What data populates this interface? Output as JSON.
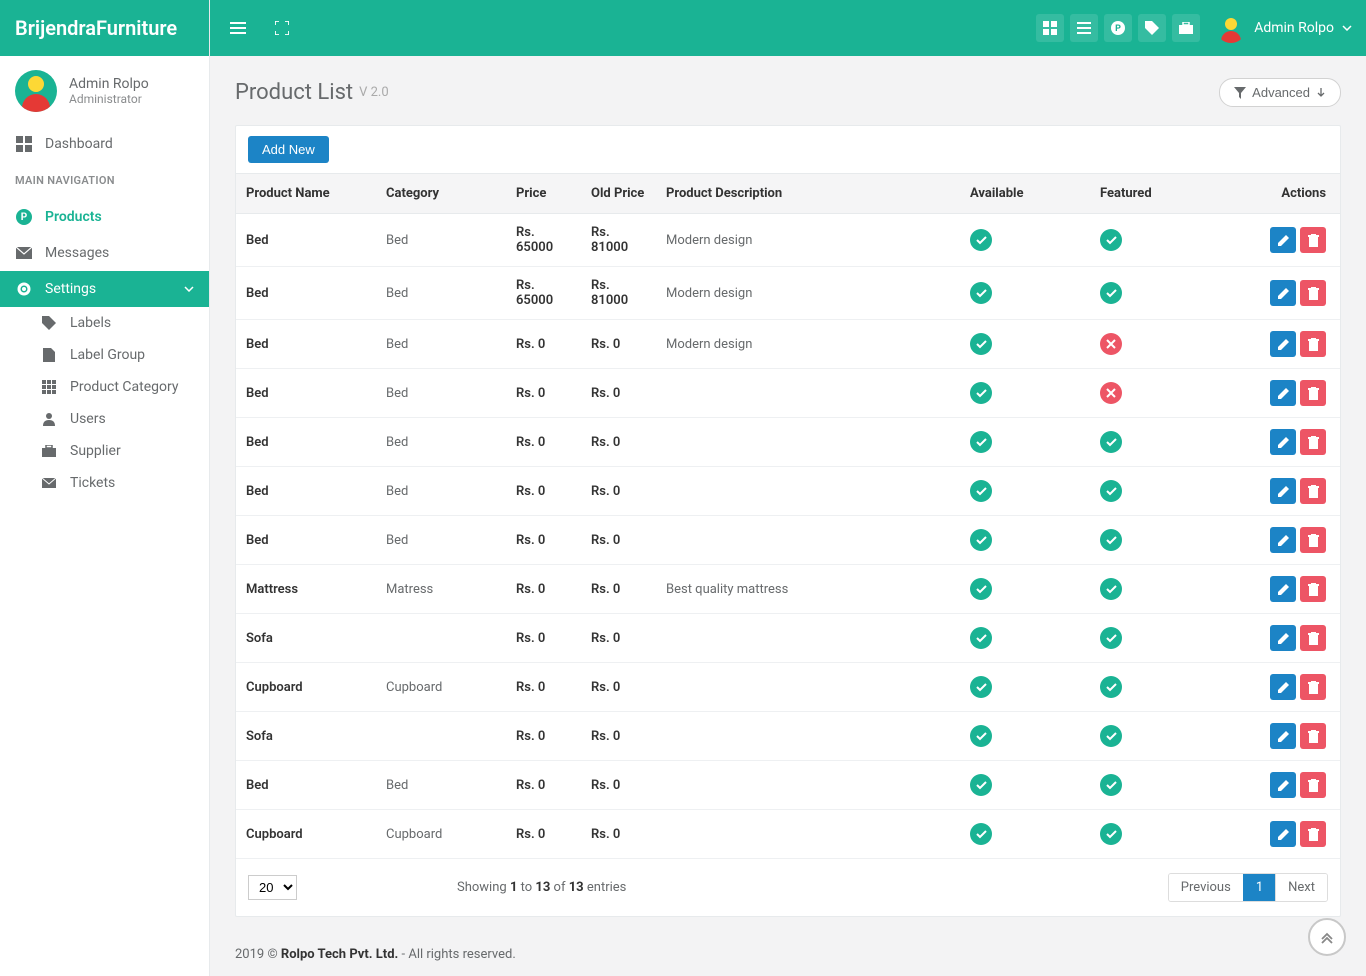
{
  "brand": "BrijendraFurniture",
  "user": {
    "name": "Admin Rolpo",
    "role": "Administrator"
  },
  "sidebar": {
    "dashboard": "Dashboard",
    "section": "MAIN NAVIGATION",
    "products": "Products",
    "messages": "Messages",
    "settings": "Settings",
    "sub": {
      "labels": "Labels",
      "label_group": "Label Group",
      "product_category": "Product Category",
      "users": "Users",
      "supplier": "Supplier",
      "tickets": "Tickets"
    }
  },
  "page": {
    "title": "Product List",
    "version": "V 2.0",
    "advanced": "Advanced"
  },
  "actions": {
    "add_new": "Add New"
  },
  "table": {
    "headers": {
      "name": "Product Name",
      "category": "Category",
      "price": "Price",
      "old_price": "Old Price",
      "description": "Product Description",
      "available": "Available",
      "featured": "Featured",
      "actions": "Actions"
    },
    "rows": [
      {
        "name": "Bed",
        "category": "Bed",
        "price": "65000",
        "old_price": "81000",
        "desc": "Modern design",
        "available": true,
        "featured": true
      },
      {
        "name": "Bed",
        "category": "Bed",
        "price": "65000",
        "old_price": "81000",
        "desc": "Modern design",
        "available": true,
        "featured": true
      },
      {
        "name": "Bed",
        "category": "Bed",
        "price": "0",
        "old_price": "0",
        "desc": "Modern design",
        "available": true,
        "featured": false
      },
      {
        "name": "Bed",
        "category": "Bed",
        "price": "0",
        "old_price": "0",
        "desc": "",
        "available": true,
        "featured": false
      },
      {
        "name": "Bed",
        "category": "Bed",
        "price": "0",
        "old_price": "0",
        "desc": "",
        "available": true,
        "featured": true
      },
      {
        "name": "Bed",
        "category": "Bed",
        "price": "0",
        "old_price": "0",
        "desc": "",
        "available": true,
        "featured": true
      },
      {
        "name": "Bed",
        "category": "Bed",
        "price": "0",
        "old_price": "0",
        "desc": "",
        "available": true,
        "featured": true
      },
      {
        "name": "Mattress",
        "category": "Matress",
        "price": "0",
        "old_price": "0",
        "desc": "Best quality mattress",
        "available": true,
        "featured": true
      },
      {
        "name": "Sofa",
        "category": "",
        "price": "0",
        "old_price": "0",
        "desc": "",
        "available": true,
        "featured": true
      },
      {
        "name": "Cupboard",
        "category": "Cupboard",
        "price": "0",
        "old_price": "0",
        "desc": "",
        "available": true,
        "featured": true
      },
      {
        "name": "Sofa",
        "category": "",
        "price": "0",
        "old_price": "0",
        "desc": "",
        "available": true,
        "featured": true
      },
      {
        "name": "Bed",
        "category": "Bed",
        "price": "0",
        "old_price": "0",
        "desc": "",
        "available": true,
        "featured": true
      },
      {
        "name": "Cupboard",
        "category": "Cupboard",
        "price": "0",
        "old_price": "0",
        "desc": "",
        "available": true,
        "featured": true
      }
    ]
  },
  "pagination": {
    "page_size": "20",
    "showing_prefix": "Showing ",
    "from": "1",
    "to_word": " to ",
    "to": "13",
    "of_word": " of ",
    "total": "13",
    "entries_word": " entries",
    "previous": "Previous",
    "page": "1",
    "next": "Next"
  },
  "footer": {
    "year": "2019 © ",
    "company": "Rolpo Tech Pvt. Ltd.",
    "rights": " - All rights reserved."
  }
}
